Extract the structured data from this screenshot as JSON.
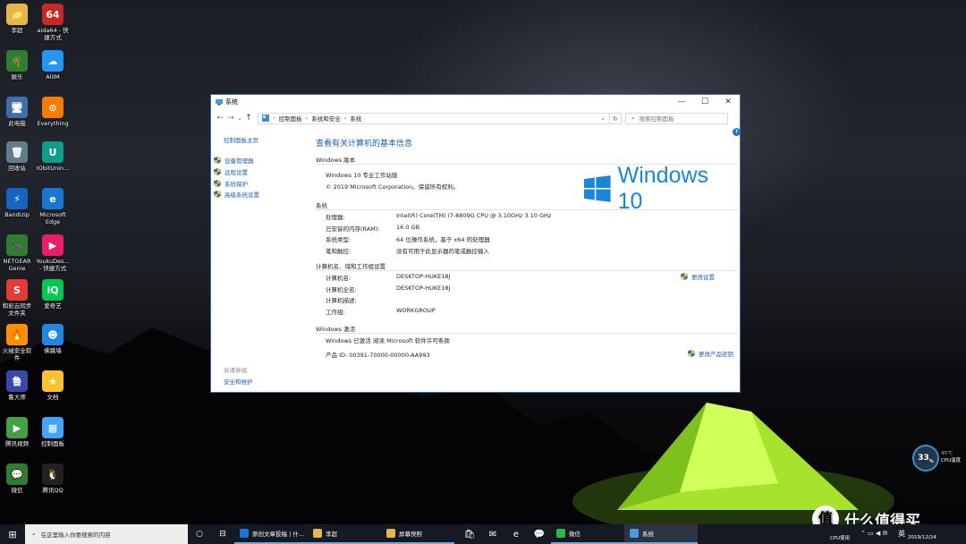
{
  "desktop_icons": [
    {
      "label": "李超",
      "symbol": "📁",
      "color": "#e8b54a"
    },
    {
      "label": "aida64 - 快\n捷方式",
      "symbol": "64",
      "color": "#c62828"
    },
    {
      "label": "娱乐",
      "symbol": "🌴",
      "color": "#2e7d32"
    },
    {
      "label": "AliIM",
      "symbol": "☁",
      "color": "#2196f3"
    },
    {
      "label": "此电脑",
      "symbol": "🖥",
      "color": "#3d6fa8"
    },
    {
      "label": "Everything",
      "symbol": "⊙",
      "color": "#f57c00"
    },
    {
      "label": "回收站",
      "symbol": "🗑",
      "color": "#607d8b"
    },
    {
      "label": "IObitUnin...",
      "symbol": "U",
      "color": "#0f9d8a"
    },
    {
      "label": "Bandizip",
      "symbol": "⚡",
      "color": "#1565c0"
    },
    {
      "label": "Microsoft\nEdge",
      "symbol": "e",
      "color": "#1976d2"
    },
    {
      "label": "NETGEAR\nGenie",
      "symbol": "🐜",
      "color": "#2e7d32"
    },
    {
      "label": "YoukuDes...\n- 快捷方式",
      "symbol": "▶",
      "color": "#e91e63"
    },
    {
      "label": "和彩云同步\n文件夹",
      "symbol": "S",
      "color": "#e53935"
    },
    {
      "label": "爱奇艺",
      "symbol": "iQ",
      "color": "#00c853"
    },
    {
      "label": "火绒安全软\n件",
      "symbol": "🔥",
      "color": "#ff8f00"
    },
    {
      "label": "佛跳墙",
      "symbol": "☻",
      "color": "#1e88e5"
    },
    {
      "label": "鲁大师",
      "symbol": "鲁",
      "color": "#3949ab"
    },
    {
      "label": "文档",
      "symbol": "★",
      "color": "#fbc02d"
    },
    {
      "label": "腾讯视频",
      "symbol": "▶",
      "color": "#43a047"
    },
    {
      "label": "控制面板",
      "symbol": "▦",
      "color": "#42a5f5"
    },
    {
      "label": "微信",
      "symbol": "💬",
      "color": "#2e7d32"
    },
    {
      "label": "腾讯QQ",
      "symbol": "🐧",
      "color": "#212121"
    }
  ],
  "window": {
    "title": "系统",
    "controls": {
      "minimize": "—",
      "maximize": "☐",
      "close": "✕"
    },
    "address": {
      "back": "←",
      "forward": "→",
      "recent": "⌄",
      "up": "↑",
      "crumbs": [
        "控制面板",
        "系统和安全",
        "系统"
      ],
      "refresh": "↻",
      "search_placeholder": "搜索控制面板"
    },
    "sidebar": {
      "home": "控制面板主页",
      "links": [
        "设备管理器",
        "远程设置",
        "系统保护",
        "高级系统设置"
      ],
      "see_also": "另请参阅",
      "security": "安全和维护"
    },
    "main": {
      "heading": "查看有关计算机的基本信息",
      "help": "?",
      "edition": {
        "section": "Windows 版本",
        "name": "Windows 10 专业工作站版",
        "copyright": "© 2019 Microsoft Corporation。保留所有权利。",
        "logo_text": "Windows 10"
      },
      "system": {
        "section": "系统",
        "rows": [
          {
            "key": "处理器:",
            "value": "Intel(R) Core(TM) i7-8809G CPU @ 3.10GHz   3.10 GHz"
          },
          {
            "key": "已安装的内存(RAM):",
            "value": "16.0 GB"
          },
          {
            "key": "系统类型:",
            "value": "64 位操作系统，基于 x64 的处理器"
          },
          {
            "key": "笔和触控:",
            "value": "没有可用于此显示器的笔或触控输入"
          }
        ]
      },
      "computer": {
        "section": "计算机名、域和工作组设置",
        "change": "更改设置",
        "rows": [
          {
            "key": "计算机名:",
            "value": "DESKTOP-HUKE18J"
          },
          {
            "key": "计算机全名:",
            "value": "DESKTOP-HUKE18J"
          },
          {
            "key": "计算机描述:",
            "value": ""
          },
          {
            "key": "工作组:",
            "value": "WORKGROUP"
          }
        ]
      },
      "activation": {
        "section": "Windows 激活",
        "status": "Windows 已激活",
        "license_link": "阅读 Microsoft 软件许可条款",
        "product_id": "产品 ID: 00391-70000-00000-AA993",
        "change_key": "更改产品密钥"
      }
    }
  },
  "gauge": {
    "value": "33",
    "unit": "%",
    "temp": "45℃",
    "label": "CPU温度"
  },
  "taskbar": {
    "start": "⊞",
    "search_placeholder": "在这里输入你要搜索的内容",
    "cortana": "○",
    "taskview": "⊟",
    "tasks": [
      {
        "label": "原创文章投稿 | 什...",
        "color": "#1976d2"
      },
      {
        "label": "李超",
        "color": "#e8b54a"
      },
      {
        "label": "屏幕快照",
        "color": "#e8b54a"
      }
    ],
    "pins": [
      "🛍",
      "✉",
      "e",
      "💬"
    ],
    "wechat": "微信",
    "active": "系统",
    "tray": {
      "cpu": "CPU使用",
      "ime": "英",
      "date": "2019/12/24"
    }
  },
  "watermark": {
    "symbol": "值",
    "text": "什么值得买"
  }
}
